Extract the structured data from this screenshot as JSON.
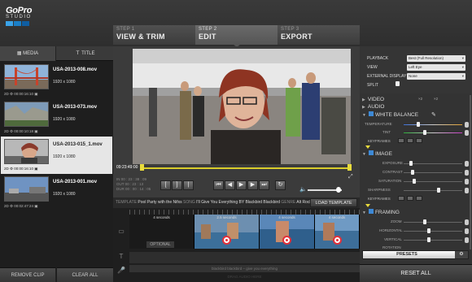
{
  "brand": {
    "name": "GoPro",
    "subtitle": "STUDIO"
  },
  "steps": [
    {
      "num": "STEP 1",
      "label": "VIEW & TRIM"
    },
    {
      "num": "STEP 2",
      "label": "EDIT"
    },
    {
      "num": "STEP 3",
      "label": "EXPORT"
    }
  ],
  "left_tabs": {
    "media": "MEDIA",
    "title": "TITLE"
  },
  "clips": [
    {
      "name": "USA-2013-008.mov",
      "res": "1920 x 1080",
      "meta": "2D  ⚙ 00:00:16:10  ▣",
      "selected": false
    },
    {
      "name": "USA-2013-073.mov",
      "res": "1920 x 1080",
      "meta": "2D  ⚙ 00:00:10:18  ▣",
      "selected": false
    },
    {
      "name": "USA-2013-015_1.mov",
      "res": "1920 x 1080",
      "meta": "2D  ⚙ 00:00:16:10  ▣",
      "selected": true
    },
    {
      "name": "USA-2013-001.mov",
      "res": "1920 x 1080",
      "meta": "2D  ⚙ 00:02:47:24  ▣",
      "selected": false
    }
  ],
  "left_buttons": {
    "remove": "REMOVE CLIP",
    "clear": "CLEAR ALL"
  },
  "player": {
    "timecode": "09:23:49:00",
    "in_out": [
      "IN    00 : 23 : 38 : 09",
      "OUT 00 : 23 : 13",
      "DUR 00 : 00 : 14 : 05"
    ],
    "volume": 0.8
  },
  "template": {
    "label": "TEMPLATE",
    "name": "Pool Party with the Nifxs",
    "song_label": "SONG",
    "song": "I'll Give You Everything BY Blackbird Blackbird",
    "genre_label": "GENRE",
    "genre": "Alt Rock",
    "load_button": "LOAD TEMPLATE"
  },
  "timeline": {
    "segments": [
      "4 seconds",
      "2.5 seconds",
      "4 seconds",
      "4 seconds"
    ],
    "optional": "OPTIONAL",
    "title_track": "blackbird blackbird – give you everything",
    "drag_hint": "DRAG AUDIO HERE"
  },
  "right": {
    "playback_label": "PLAYBACK",
    "playback_value": "Best (Full Resolution)",
    "view_label": "VIEW",
    "view_value": "Left Eye",
    "ext_label": "EXTERNAL DISPLAY",
    "ext_value": "None",
    "split_label": "SPLIT",
    "sections": {
      "video": "VIDEO",
      "audio": "AUDIO",
      "white_balance": "WHITE BALANCE",
      "image": "IMAGE",
      "framing": "FRAMING"
    },
    "video_speed": [
      "×2",
      "×2"
    ],
    "wb_sliders": [
      "TEMPERATURE",
      "TINT"
    ],
    "keyframes": "KEYFRAMES",
    "image_sliders": [
      "EXPOSURE",
      "CONTRAST",
      "SATURATION",
      "SHARPNESS"
    ],
    "framing_sliders": [
      "ZOOM",
      "HORIZONTAL",
      "VERTICAL",
      "ROTATION"
    ],
    "presets": "PRESETS",
    "reset": "RESET ALL"
  },
  "colors": {
    "accent_blue": "#3d89d6",
    "scrub_yellow": "#d9cc2b",
    "record_red": "#e2303a"
  }
}
